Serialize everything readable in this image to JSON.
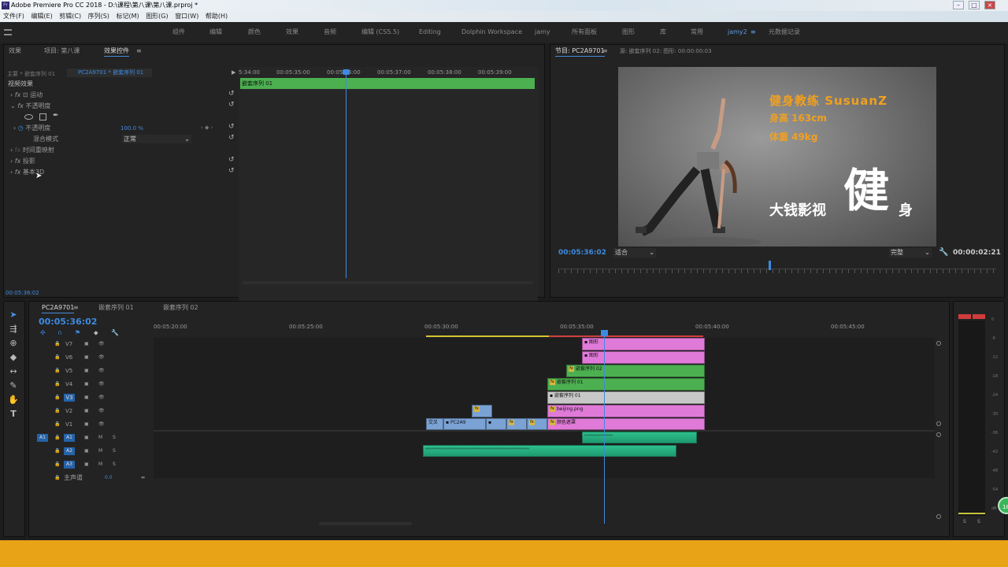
{
  "title": "Adobe Premiere Pro CC 2018 - D:\\课程\\第八课\\第八课.prproj *",
  "menu": [
    "文件(F)",
    "编辑(E)",
    "剪辑(C)",
    "序列(S)",
    "标记(M)",
    "图形(G)",
    "窗口(W)",
    "帮助(H)"
  ],
  "workspaces": [
    "组件",
    "编辑",
    "颜色",
    "效果",
    "音频",
    "编辑 (CS5.5)",
    "Editing",
    "Dolphin Workspace",
    "jamy",
    "所有面板",
    "图形",
    "库",
    "常用",
    "jamy2",
    "元数据记录"
  ],
  "ws_menu_icon": "≡",
  "effect_controls": {
    "tabs": [
      "效果",
      "项目: 第八课",
      "效果控件"
    ],
    "panel_menu": "≡",
    "source": "主要 * 嵌套序列 01",
    "seq": "PC2A9701 * 嵌套序列 01",
    "section": "视频效果",
    "fx_label": "fx",
    "motion": "运动",
    "opacity": "不透明度",
    "opacity_param": "不透明度",
    "opacity_value": "100.0 %",
    "blend": "混合模式",
    "blend_value": "正常",
    "timeremap": "时间重映射",
    "shadow": "投影",
    "basic3d": "基本3D",
    "timecode": "00:05:36:02",
    "mini_times": [
      "5:34:00",
      "00:05:35:00",
      "00:05:36:00",
      "00:05:37:00",
      "00:05:38:00",
      "00:05:39:00"
    ],
    "mini_clip": "嵌套序列 01"
  },
  "program": {
    "tab": "节目: PC2A9701",
    "panel_menu": "≡",
    "source_tab": "源: 嵌套序列 02: 图形: 00:00:00:03",
    "frame": {
      "line1": "健身教练  SusuanZ",
      "line2": "身高 163cm",
      "line3": "体重 49kg",
      "brand": "大钱影视",
      "big_char": "健",
      "suffix": "身"
    },
    "timecode": "00:05:36:02",
    "fit": "适合",
    "quality": "完整",
    "duration": "00:00:02:21"
  },
  "timeline": {
    "tabs": [
      "PC2A9701",
      "嵌套序列 01",
      "嵌套序列 02"
    ],
    "panel_menu": "≡",
    "timecode": "00:05:36:02",
    "ruler": [
      "00:05:20:00",
      "00:05:25:00",
      "00:05:30:00",
      "00:05:35:00",
      "00:05:40:00",
      "00:05:45:00"
    ],
    "video_tracks": [
      "V7",
      "V6",
      "V5",
      "V4",
      "V3",
      "V2",
      "V1"
    ],
    "audio_tracks": [
      "A1",
      "A2",
      "A3"
    ],
    "src_patch": "A1",
    "m": "M",
    "s": "S",
    "master": "主声道",
    "master_val": "0.0",
    "clips": {
      "v7": "图形",
      "v6": "图形",
      "v5": "嵌套序列 02",
      "v4": "嵌套序列 01",
      "v3": "嵌套序列 01",
      "v2": "beijing.png",
      "v1": "颜色遮罩",
      "v1b": "PC2A9",
      "v1c": "交叉"
    }
  },
  "meter": {
    "labels": [
      "0",
      "-6",
      "-12",
      "-18",
      "-24",
      "-30",
      "-36",
      "-42",
      "-48",
      "-54",
      "dB"
    ],
    "s": "S"
  },
  "badge": "18",
  "colors": {
    "accent": "#3d8ae0",
    "pink": "#e07ad8",
    "green": "#4caf50",
    "audio": "#2dbf8c",
    "clip_blue": "#7aa2d4",
    "bottom_bar": "#e8a317"
  }
}
